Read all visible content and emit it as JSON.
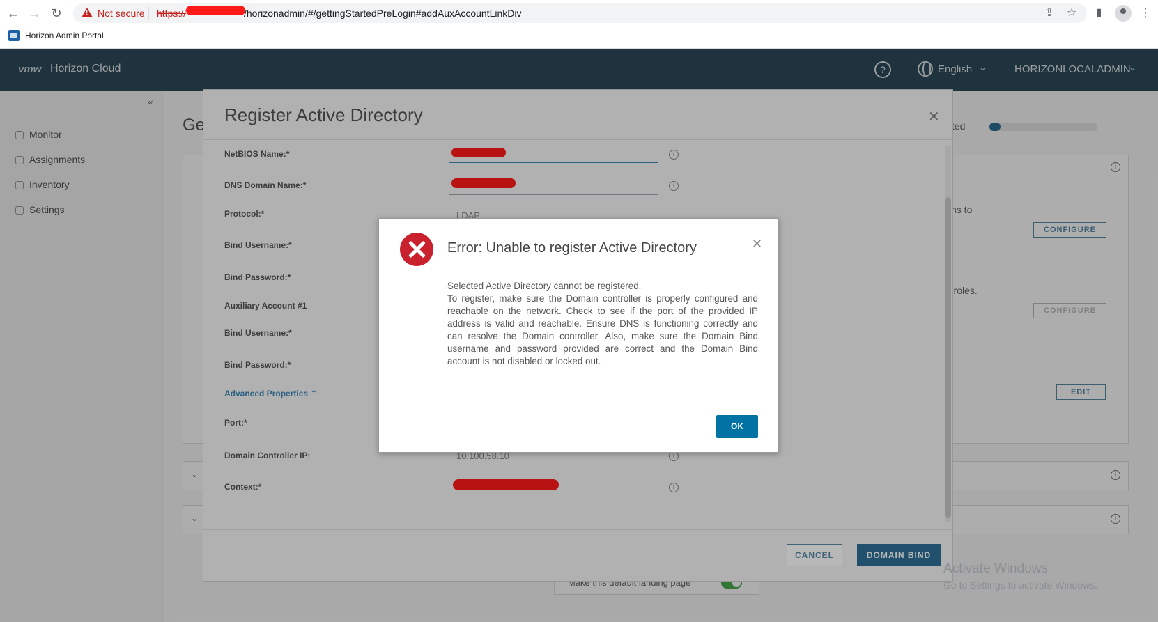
{
  "browser": {
    "not_secure": "Not secure",
    "url_scheme": "https://",
    "url_path": "/horizonadmin/#/gettingStartedPreLogin#addAuxAccountLinkDiv",
    "bookmark": "Horizon Admin Portal"
  },
  "header": {
    "logo": "vmw",
    "app_name": "Horizon Cloud",
    "language": "English",
    "user": "HORIZONLOCALADMIN"
  },
  "sidebar": {
    "items": [
      {
        "label": "Monitor"
      },
      {
        "label": "Assignments"
      },
      {
        "label": "Inventory"
      },
      {
        "label": "Settings"
      }
    ]
  },
  "background": {
    "title_fragment": "Ge",
    "progress_label": "leted",
    "progress_fraction": 0.1,
    "text_1": "ns to",
    "text_2": "r roles.",
    "configure_1": "CONFIGURE",
    "configure_2": "CONFIGURE",
    "edit": "EDIT",
    "default_landing": "Make this default landing page"
  },
  "register_modal": {
    "title": "Register Active Directory",
    "fields": {
      "netbios": "NetBIOS Name:*",
      "dns": "DNS Domain Name:*",
      "protocol": "Protocol:*",
      "protocol_value": "LDAP",
      "bind_username": "Bind Username:*",
      "bind_password": "Bind Password:*",
      "aux_account": "Auxiliary Account #1",
      "aux_bind_username": "Bind Username:*",
      "aux_bind_password": "Bind Password:*",
      "advanced": "Advanced Properties",
      "port": "Port:*",
      "dc_ip": "Domain Controller IP:",
      "dc_ip_value": "10.100.58.10",
      "context": "Context:*"
    },
    "cancel": "CANCEL",
    "domain_bind": "DOMAIN BIND"
  },
  "error_modal": {
    "title": "Error: Unable to register Active Directory",
    "line1": "Selected Active Directory cannot be registered.",
    "line2": "To register, make sure the Domain controller is properly configured and reachable on the network. Check to see if the port of the provided IP address is valid and reachable. Ensure DNS is functioning correctly and can resolve the Domain controller. Also, make sure the Domain Bind username and password provided are correct and the Domain Bind account is not disabled or locked out.",
    "ok": "OK"
  },
  "windows": {
    "activate": "Activate Windows",
    "activate_sub": "Go to Settings to activate Windows."
  }
}
